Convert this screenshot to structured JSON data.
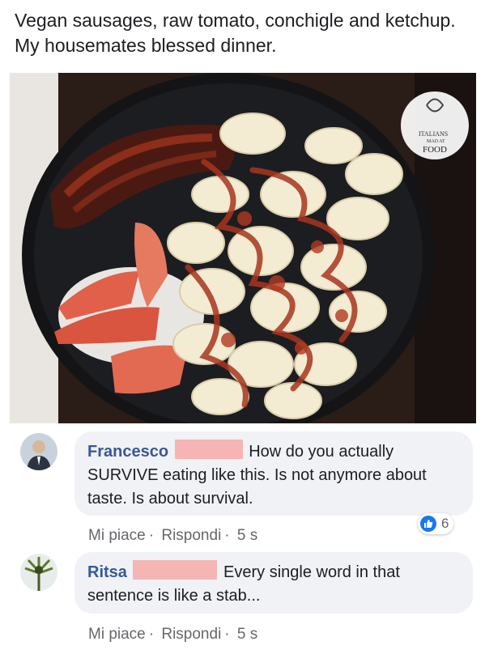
{
  "post": {
    "caption": "Vegan sausages, raw tomato, conchigle and ketchup. My housemates blessed dinner."
  },
  "photo": {
    "logo_line1": "ITALIANS",
    "logo_line2": "MAD AT",
    "logo_line3": "FOOD"
  },
  "comments": [
    {
      "author": "Francesco",
      "text": "How do you actually SURVIVE eating like this. Is not anymore about taste. Is about survival.",
      "like_label": "Mi piace",
      "reply_label": "Rispondi",
      "time": "5 s",
      "reaction_count": "6"
    },
    {
      "author": "Ritsa",
      "text": "Every single word in that sentence is like a stab...",
      "like_label": "Mi piace",
      "reply_label": "Rispondi",
      "time": "5 s"
    }
  ],
  "colors": {
    "author": "#385898",
    "bubble": "#f0f2f5",
    "like_blue": "#1877f2",
    "redaction": "#f5b5b5"
  }
}
